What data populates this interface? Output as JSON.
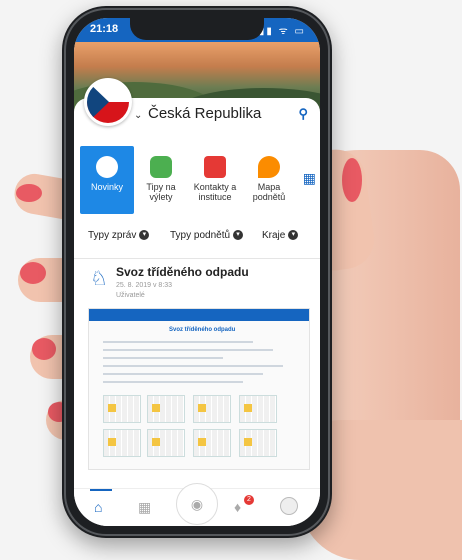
{
  "status": {
    "time": "21:18",
    "signal": "▮▮ ᯤ ▭"
  },
  "header": {
    "country": "Česká Republika"
  },
  "menu": [
    {
      "label": "Novinky",
      "active": true
    },
    {
      "label": "Tipy na výlety",
      "active": false
    },
    {
      "label": "Kontakty a instituce",
      "active": false
    },
    {
      "label": "Mapa podnětů",
      "active": false
    }
  ],
  "filters": [
    {
      "label": "Typy zpráv"
    },
    {
      "label": "Typy podnětů"
    },
    {
      "label": "Kraje"
    }
  ],
  "post": {
    "title": "Svoz tříděného odpadu",
    "date": "25. 8. 2019 v 8:33",
    "source": "Uživatelé",
    "document_title": "Svoz tříděného odpadu"
  },
  "nav": {
    "notification_count": "2"
  },
  "colors": {
    "accent": "#1565c0",
    "active_tile": "#1e88e5",
    "nail": "#e85a63"
  }
}
